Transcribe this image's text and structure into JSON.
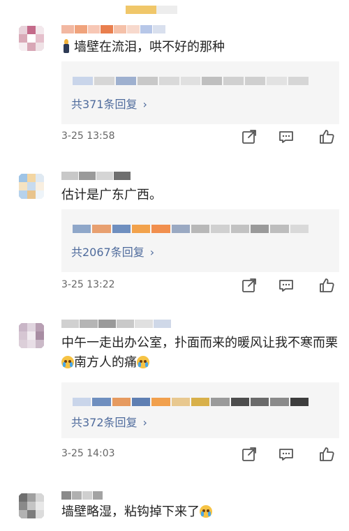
{
  "comments": [
    {
      "text": "墙壁在流泪，哄不好的那种",
      "reply_link": "共371条回复",
      "time": "3-25 13:58",
      "avatar_colors": [
        "#e8d2da",
        "#c46a8a",
        "#f3e8ec",
        "#d9aab8",
        "#ffffff",
        "#e5c0cc",
        "#f6eef1",
        "#d8a7b6",
        "#efe2e6"
      ],
      "name_colors": [
        "#f2b8a2",
        "#f0a37c",
        "#f7c7b5",
        "#e97f4e",
        "#f5c1a9",
        "#f7d9cd",
        "#b7c7e8",
        "#d9e0ee"
      ],
      "reply_mosaic_colors": [
        "#c9d5ea",
        "#d6d6d6",
        "#9eb0cf",
        "#c8c8c8",
        "#d9d9d9",
        "#e0e0e0",
        "#bfbfbf",
        "#d0d0d0",
        "#cfcfcf",
        "#e2e2e2",
        "#d6d6d6"
      ]
    },
    {
      "text": "估计是广东广西。",
      "reply_link": "共2067条回复",
      "time": "3-25 13:22",
      "avatar_colors": [
        "#9fc4e6",
        "#f3d6a3",
        "#dfe9f2",
        "#f5e3c2",
        "#c8dbee",
        "#f9efe0",
        "#b6d2ec",
        "#e8c48d",
        "#eef4f9"
      ],
      "name_colors": [
        "#c8c8c8",
        "#9a9a9a",
        "#d5d5d5",
        "#6f6f6f"
      ],
      "reply_mosaic_colors": [
        "#8fa7c9",
        "#e8a070",
        "#6f8fbf",
        "#f2a24c",
        "#f18f4e",
        "#9aa9c2",
        "#b8b8b8",
        "#d0d0d0",
        "#c2c2c2",
        "#9a9a9a",
        "#bdbdbd",
        "#d9d9d9"
      ]
    },
    {
      "text": "中午一走出办公室，扑面而来的暖风让我不寒而栗",
      "text2": "南方人的痛",
      "reply_link": "共372条回复",
      "time": "3-25 14:03",
      "avatar_colors": [
        "#c9b6c7",
        "#e0d5df",
        "#b89fb3",
        "#d6c6d3",
        "#f1ebf0",
        "#a88da3",
        "#dccfd9",
        "#e8dee6",
        "#cbbac8"
      ],
      "name_colors": [
        "#d0d0d0",
        "#b5b5b5",
        "#9a9a9a",
        "#c9c9c9",
        "#e0e0e0",
        "#cfd8e8"
      ],
      "reply_mosaic_colors": [
        "#c9d5ea",
        "#6f8fbf",
        "#e69a5f",
        "#5f7fb2",
        "#f1a04d",
        "#e8c88f",
        "#d8b04a",
        "#9a9a9a",
        "#4d4d4d",
        "#6a6a6a",
        "#8a8a8a",
        "#3d3d3d"
      ]
    },
    {
      "text": "墙壁略湿，粘钩掉下来了",
      "avatar_colors": [
        "#6f6f6f",
        "#a0a0a0",
        "#d6d6d6",
        "#8a8a8a",
        "#c4c4c4",
        "#e8e8e8",
        "#b2b2b2",
        "#7c7c7c",
        "#dcdcdc"
      ],
      "name_colors": [
        "#8a8a8a",
        "#b0b0b0",
        "#cfcfcf",
        "#a3a3a3"
      ]
    }
  ],
  "top_strip_colors": [
    "#f0c76a",
    "#ededed"
  ],
  "icons": {
    "share": "share-icon",
    "comment": "comment-icon",
    "like": "like-icon",
    "chevron": "chevron-right-icon",
    "candle": "candle-emoji-icon",
    "crying": "crying-emoji-icon"
  },
  "colors": {
    "link": "#4f6b9c",
    "reply_bg": "#f5f5f5",
    "meta_text": "#666666"
  }
}
